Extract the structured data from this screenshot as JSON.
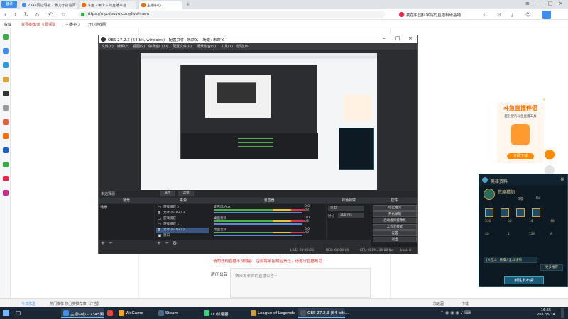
{
  "browser": {
    "tabs": [
      {
        "label": "2345网址导航 - 致力于打造百",
        "color": "#3d8ef0"
      },
      {
        "label": "斗鱼 - 每个人的直播平台",
        "color": "#ff6a00"
      },
      {
        "label": "主播中心",
        "color": "#ff6a00"
      }
    ],
    "brand_button": "登录",
    "address": "https://mp.douyu.com/live/main",
    "news_text": "我在中国科学院的直播科研基地",
    "bookmarks": [
      "收藏",
      "首页 | 首页推荐",
      "主播中心",
      "开心游戏网"
    ],
    "bookmark_notice": "首页推荐/单  立即领取"
  },
  "page": {
    "warning_text": "请勿违规直播不良内容，否则将承担相应责任，请遵守直播规范",
    "notice_label": "房间公告：",
    "notice_placeholder": "快来发布你的直播公告~"
  },
  "obs": {
    "title": "OBS 27.2.3 (64-bit, windows) - 配置文件: 未命名 - 场景: 未命名",
    "menu": [
      "文件(F)",
      "编辑(E)",
      "视图(V)",
      "停靠窗口(D)",
      "配置文件(P)",
      "场景集合(S)",
      "工具(T)",
      "帮助(H)"
    ],
    "current_scene_label": "未选择源",
    "properties_label": "属性",
    "filters_label": "滤镜",
    "panels": {
      "scenes": "场景",
      "sources": "来源",
      "mixer": "混音器",
      "transitions": "转场特效",
      "controls": "控件"
    },
    "scene_list": [
      "场景"
    ],
    "sources": [
      {
        "label": "游戏捕获 2",
        "icon": "game-capture",
        "selected": false
      },
      {
        "label": "文本 (GDI+) 3",
        "icon": "text",
        "selected": false
      },
      {
        "label": "游戏捕获",
        "icon": "game-capture",
        "selected": false
      },
      {
        "label": "游戏捕获 1",
        "icon": "game-capture",
        "selected": false
      },
      {
        "label": "文本 (GDI+) 2",
        "icon": "text",
        "selected": true
      },
      {
        "label": "窗口",
        "icon": "window",
        "selected": false
      }
    ],
    "mixer": [
      {
        "name": "麦克风/Aux",
        "db": "0.0 dB"
      },
      {
        "name": "桌面音频",
        "db": "0.0 dB"
      },
      {
        "name": "桌面音频",
        "db": "0.0 dB"
      }
    ],
    "transition": {
      "type": "淡出",
      "duration_label": "时长",
      "duration": "300 ms"
    },
    "controls": [
      "停止推流",
      "开始录制",
      "启动虚拟摄像机",
      "工作室模式",
      "设置",
      "退出"
    ],
    "status": {
      "live": "LIVE: 00:00:00",
      "rec": "REC: 00:00:00",
      "cpu": "CPU: 0.8%, 30.00 fps",
      "kbps": "kb/s: 0"
    }
  },
  "ad": {
    "title": "斗鱼直播伴侣",
    "subtitle": "超轻便的斗鱼直播工具",
    "button": "立即下载",
    "close": "×"
  },
  "lol_panel": {
    "title": "英雄资料",
    "hero_name": "荒原猎豹",
    "level": "8级",
    "level_right": "LV",
    "stats": [
      "330",
      "55",
      "14",
      "48",
      "40",
      "1",
      "120",
      "6"
    ],
    "skin_label": "[大乱斗] 暴躁大乱斗法师",
    "recommend": "更多推荐",
    "button": "前往发布会"
  },
  "statusbar": {
    "left": "今日优选",
    "ad": "热门推荐  热分类推荐章【广告】",
    "right_items": [
      "加速器",
      "下载"
    ]
  },
  "taskbar": {
    "apps": [
      {
        "label": "主播中心 - 2345网...",
        "color": "#3d8ef0",
        "active": true
      },
      {
        "label": "",
        "color": "#e8483b",
        "active": false
      },
      {
        "label": "WeGame",
        "color": "#f5a623",
        "active": false
      },
      {
        "label": "Steam",
        "color": "#1b2838",
        "active": false
      },
      {
        "label": "UU加速器",
        "color": "#3ad07f",
        "active": false
      },
      {
        "label": "League of Legends",
        "color": "#c89b3c",
        "active": false
      },
      {
        "label": "OBS 27.2.3 (64-bit)...",
        "color": "#444",
        "active": true
      }
    ],
    "time": "16:55",
    "date": "2022/5/14"
  }
}
